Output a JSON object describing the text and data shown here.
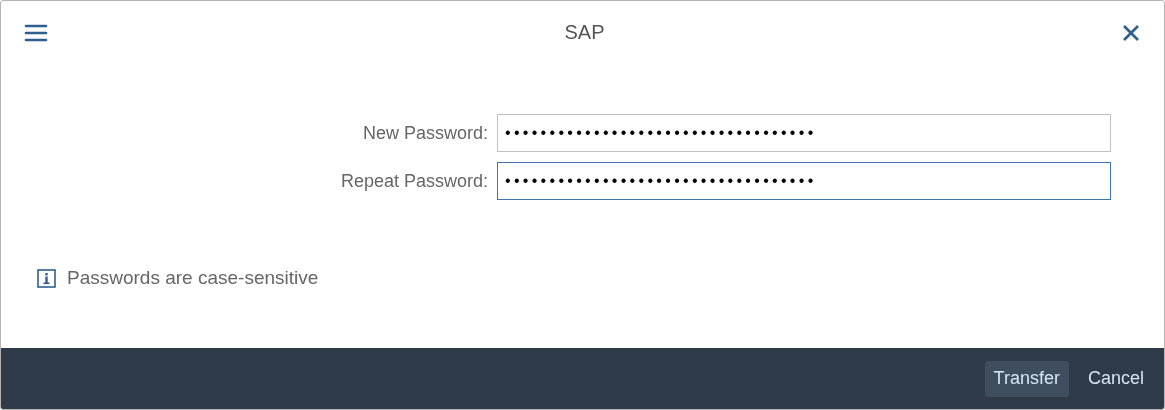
{
  "dialog": {
    "title": "SAP"
  },
  "fields": [
    {
      "label": "New Password:",
      "value": "•••••••••••••••••••••••••••••••••••",
      "focused": false
    },
    {
      "label": "Repeat Password:",
      "value": "•••••••••••••••••••••••••••••••••••",
      "focused": true
    }
  ],
  "info": "Passwords are case-sensitive",
  "buttons": [
    {
      "label": "Transfer",
      "hovered": true
    },
    {
      "label": "Cancel",
      "hovered": false
    }
  ]
}
